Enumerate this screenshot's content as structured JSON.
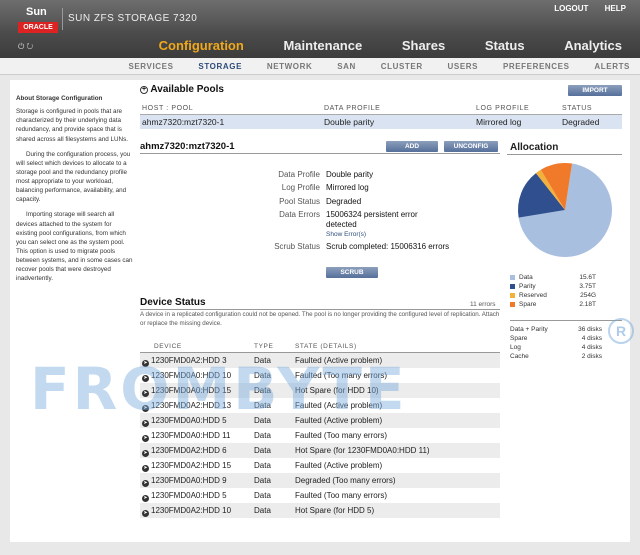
{
  "header": {
    "brand": "Sun",
    "brand_badge": "ORACLE",
    "product_title": "SUN ZFS STORAGE 7320",
    "logout": "LOGOUT",
    "help": "HELP",
    "power_icons": "⏻  ↻"
  },
  "main_tabs": [
    "Configuration",
    "Maintenance",
    "Shares",
    "Status",
    "Analytics"
  ],
  "active_main_tab": "Configuration",
  "subnav": [
    "SERVICES",
    "STORAGE",
    "NETWORK",
    "SAN",
    "CLUSTER",
    "USERS",
    "PREFERENCES",
    "ALERTS"
  ],
  "active_subnav": "STORAGE",
  "help_panel": {
    "title": "About Storage Configuration",
    "p1": "Storage is configured in pools that are characterized by their underlying data redundancy, and provide space that is shared across all filesystems and LUNs.",
    "p2": "During the configuration process, you will select which devices to allocate to a storage pool and the redundancy profile most appropriate to your workload, balancing performance, availability, and capacity.",
    "p3": "Importing storage will search all devices attached to the system for existing pool configurations, from which you can select one as the system pool. This option is used to migrate pools between systems, and in some cases can recover pools that were destroyed inadvertently."
  },
  "available_pools": {
    "title": "Available Pools",
    "import_button": "IMPORT",
    "columns": [
      "HOST : POOL",
      "DATA PROFILE",
      "LOG PROFILE",
      "STATUS"
    ],
    "rows": [
      {
        "host_pool": "ahmz7320:mzt7320-1",
        "data_profile": "Double parity",
        "log_profile": "Mirrored log",
        "status": "Degraded"
      }
    ]
  },
  "pool_detail": {
    "title": "ahmz7320:mzt7320-1",
    "add_button": "ADD",
    "unconfig_button": "UNCONFIG",
    "scrub_button": "SCRUB",
    "fields": {
      "data_profile_label": "Data Profile",
      "data_profile": "Double parity",
      "log_profile_label": "Log Profile",
      "log_profile": "Mirrored log",
      "pool_status_label": "Pool Status",
      "pool_status": "Degraded",
      "data_errors_label": "Data Errors",
      "data_errors": "15006324 persistent error detected",
      "show_errors": "Show Error(s)",
      "scrub_status_label": "Scrub Status",
      "scrub_status": "Scrub completed: 15006316 errors"
    }
  },
  "allocation": {
    "title": "Allocation",
    "colors": {
      "data": "#a9bfe0",
      "parity": "#2f4f8f",
      "reserved": "#f2b13a",
      "spare": "#f07a2a"
    },
    "legend": [
      {
        "name": "Data",
        "value": "15.6T",
        "fraction": 0.7
      },
      {
        "name": "Parity",
        "value": "3.75T",
        "fraction": 0.17
      },
      {
        "name": "Reserved",
        "value": "254G",
        "fraction": 0.02
      },
      {
        "name": "Spare",
        "value": "2.18T",
        "fraction": 0.11
      }
    ],
    "disks": [
      {
        "name": "Data + Parity",
        "value": "36 disks"
      },
      {
        "name": "Spare",
        "value": "4 disks"
      },
      {
        "name": "Log",
        "value": "4 disks"
      },
      {
        "name": "Cache",
        "value": "2 disks"
      }
    ]
  },
  "device_status": {
    "title": "Device Status",
    "errors_count": "11 errors",
    "note": "A device in a replicated configuration could not be opened. The pool is no longer providing the configured level of replication. Attach or replace the missing device.",
    "columns": [
      "DEVICE",
      "TYPE",
      "STATE (DETAILS)"
    ],
    "rows": [
      {
        "device": "1230FMD0A2:HDD 3",
        "type": "Data",
        "state": "Faulted (Active problem)"
      },
      {
        "device": "1230FMD0A0:HDD 10",
        "type": "Data",
        "state": "Faulted (Too many errors)"
      },
      {
        "device": "1230FMD0A0:HDD 15",
        "type": "Data",
        "state": "Hot Spare (for HDD 10)"
      },
      {
        "device": "1230FMD0A2:HDD 13",
        "type": "Data",
        "state": "Faulted (Active problem)"
      },
      {
        "device": "1230FMD0A0:HDD 5",
        "type": "Data",
        "state": "Faulted (Active problem)"
      },
      {
        "device": "1230FMD0A0:HDD 11",
        "type": "Data",
        "state": "Faulted (Too many errors)"
      },
      {
        "device": "1230FMD0A2:HDD 6",
        "type": "Data",
        "state": "Hot Spare (for 1230FMD0A0:HDD 11)"
      },
      {
        "device": "1230FMD0A2:HDD 15",
        "type": "Data",
        "state": "Faulted (Active problem)"
      },
      {
        "device": "1230FMD0A0:HDD 9",
        "type": "Data",
        "state": "Degraded (Too many errors)"
      },
      {
        "device": "1230FMD0A0:HDD 5",
        "type": "Data",
        "state": "Faulted (Too many errors)"
      },
      {
        "device": "1230FMD0A2:HDD 10",
        "type": "Data",
        "state": "Hot Spare (for HDD 5)"
      }
    ]
  },
  "watermark": "FROMBYTE",
  "watermark_mark": "R"
}
